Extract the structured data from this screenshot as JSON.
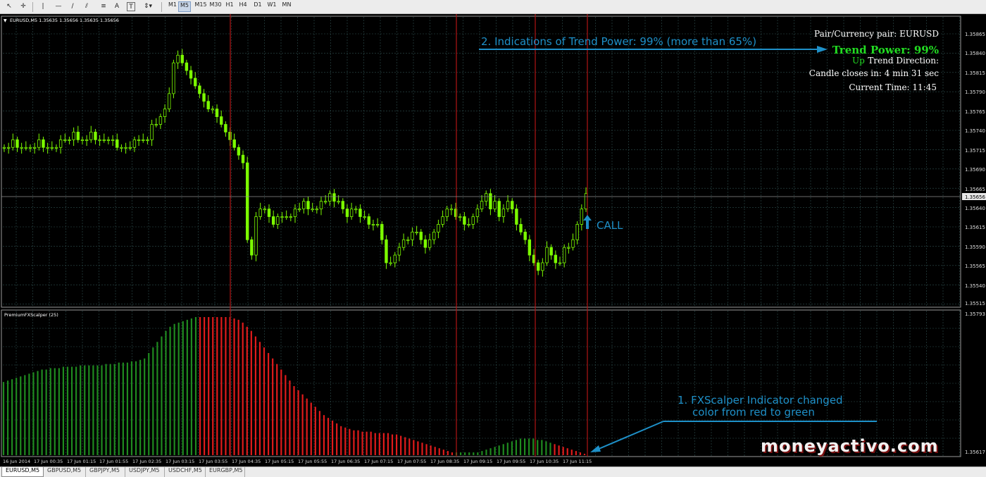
{
  "toolbar": {
    "tools": [
      "cursor-tool",
      "crosshair-tool",
      "vertical-line-tool",
      "horizontal-line-tool",
      "trendline-tool",
      "channel-tool",
      "fibonacci-tool",
      "text-tool",
      "label-tool",
      "arrows-tool"
    ],
    "text_tool_label": "A",
    "label_tool_label": "T",
    "timeframes": [
      "M1",
      "M5",
      "M15",
      "M30",
      "H1",
      "H4",
      "D1",
      "W1",
      "MN"
    ],
    "active_timeframe": "M5"
  },
  "main_chart": {
    "header": "EURUSD,M5  1.35635 1.35656 1.35635 1.35656",
    "price_ticks": [
      "1.35865",
      "1.35840",
      "1.35815",
      "1.35790",
      "1.35765",
      "1.35740",
      "1.35715",
      "1.35690",
      "1.35665",
      "1.35640",
      "1.35615",
      "1.35590",
      "1.35565",
      "1.35540",
      "1.35515"
    ],
    "current_price": "1.35656",
    "call_label": "CALL"
  },
  "indicator": {
    "name": "PremiumFXScalper (25)",
    "scale_top": "1.35793",
    "scale_bottom": "1.35617"
  },
  "info_panel": {
    "pair": "Pair/Currency pair: EURUSD",
    "trend_power": "Trend Power: 99%",
    "trend_direction_prefix": "Up",
    "trend_direction": "Trend Direction:",
    "candle_closes": "Candle closes in: 4 min 31 sec",
    "current_time": "Current Time: 11:45"
  },
  "annotations": {
    "trend_note": "2. Indications of Trend Power: 99% (more than 65%)",
    "indicator_note_line1": "1. FXScalper Indicator changed",
    "indicator_note_line2": "color from red to green"
  },
  "watermark": "moneyactivo.com",
  "time_axis": [
    "16 Jun 2014",
    "17 Jun 00:35",
    "17 Jun 01:15",
    "17 Jun 01:55",
    "17 Jun 02:35",
    "17 Jun 03:15",
    "17 Jun 03:55",
    "17 Jun 04:35",
    "17 Jun 05:15",
    "17 Jun 05:55",
    "17 Jun 06:35",
    "17 Jun 07:15",
    "17 Jun 07:55",
    "17 Jun 08:35",
    "17 Jun 09:15",
    "17 Jun 09:55",
    "17 Jun 10:35",
    "17 Jun 11:15"
  ],
  "symbol_tabs": [
    "EURUSD,M5",
    "GBPUSD,M5",
    "GBPJPY,M5",
    "USDJPY,M5",
    "USDCHF,M5",
    "EURGBP,M5"
  ],
  "active_tab": "EURUSD,M5",
  "colors": {
    "background": "#000000",
    "grid": "#2f4f4f",
    "candle": "#7cfc00",
    "histogram_green": "#1f8a1f",
    "histogram_red": "#e01b1b",
    "vertical_markers": "#b01414",
    "annotation": "#1e90c8",
    "trend_power": "#22dd22",
    "info_text": "#ffffff"
  },
  "chart_data": {
    "type": "candlestick",
    "price_close_trace": [
      1.3572,
      1.3572,
      1.3573,
      1.3572,
      1.3572,
      1.3572,
      1.3572,
      1.3572,
      1.3573,
      1.3572,
      1.3572,
      1.3572,
      1.3572,
      1.3573,
      1.3573,
      1.3573,
      1.3574,
      1.3573,
      1.3573,
      1.3573,
      1.3574,
      1.3573,
      1.3573,
      1.3573,
      1.3573,
      1.3573,
      1.3572,
      1.3572,
      1.3572,
      1.3572,
      1.3573,
      1.3573,
      1.3573,
      1.3573,
      1.3575,
      1.3575,
      1.3576,
      1.3577,
      1.3579,
      1.3583,
      1.3584,
      1.3583,
      1.3582,
      1.3581,
      1.358,
      1.3579,
      1.3578,
      1.3577,
      1.3577,
      1.3576,
      1.3575,
      1.3574,
      1.3573,
      1.3572,
      1.3571,
      1.357,
      1.356,
      1.3558,
      1.3563,
      1.3564,
      1.3564,
      1.3563,
      1.3562,
      1.3563,
      1.3563,
      1.3563,
      1.3563,
      1.3564,
      1.3564,
      1.3565,
      1.3564,
      1.3564,
      1.3564,
      1.3565,
      1.3565,
      1.3566,
      1.3565,
      1.3565,
      1.3564,
      1.3563,
      1.3564,
      1.3564,
      1.3563,
      1.3563,
      1.3562,
      1.3562,
      1.3562,
      1.356,
      1.3557,
      1.3557,
      1.3558,
      1.3559,
      1.356,
      1.356,
      1.3561,
      1.3561,
      1.356,
      1.3559,
      1.356,
      1.3561,
      1.3562,
      1.3563,
      1.3564,
      1.3564,
      1.3563,
      1.3563,
      1.3562,
      1.3562,
      1.3563,
      1.3564,
      1.3565,
      1.3566,
      1.3564,
      1.3565,
      1.3563,
      1.3564,
      1.3565,
      1.3564,
      1.3562,
      1.3561,
      1.356,
      1.3558,
      1.3557,
      1.3556,
      1.3557,
      1.3559,
      1.3558,
      1.3557,
      1.3557,
      1.3559,
      1.3559,
      1.356,
      1.3562,
      1.3564,
      1.3566
    ],
    "histogram": [
      0.53,
      0.54,
      0.55,
      0.56,
      0.57,
      0.58,
      0.59,
      0.6,
      0.61,
      0.62,
      0.62,
      0.63,
      0.63,
      0.63,
      0.64,
      0.64,
      0.64,
      0.64,
      0.65,
      0.65,
      0.65,
      0.65,
      0.65,
      0.65,
      0.66,
      0.66,
      0.66,
      0.67,
      0.67,
      0.67,
      0.68,
      0.68,
      0.69,
      0.7,
      0.74,
      0.78,
      0.82,
      0.86,
      0.9,
      0.93,
      0.95,
      0.96,
      0.97,
      0.98,
      0.99,
      1.0,
      1.0,
      1.0,
      1.0,
      1.0,
      1.0,
      1.0,
      1.0,
      1.0,
      0.99,
      0.98,
      0.96,
      0.93,
      0.9,
      0.86,
      0.82,
      0.78,
      0.74,
      0.7,
      0.66,
      0.62,
      0.58,
      0.54,
      0.5,
      0.47,
      0.44,
      0.41,
      0.38,
      0.35,
      0.32,
      0.29,
      0.27,
      0.25,
      0.23,
      0.21,
      0.2,
      0.19,
      0.18,
      0.18,
      0.17,
      0.17,
      0.17,
      0.16,
      0.16,
      0.16,
      0.16,
      0.15,
      0.15,
      0.14,
      0.13,
      0.12,
      0.11,
      0.1,
      0.09,
      0.08,
      0.07,
      0.06,
      0.05,
      0.04,
      0.03,
      0.02,
      0.02,
      0.02,
      0.02,
      0.02,
      0.02,
      0.02,
      0.03,
      0.04,
      0.05,
      0.06,
      0.07,
      0.08,
      0.09,
      0.1,
      0.11,
      0.12,
      0.12,
      0.12,
      0.12,
      0.11,
      0.11,
      0.1,
      0.09,
      0.08,
      0.07,
      0.06,
      0.05,
      0.04,
      0.03,
      0.02,
      0.01
    ],
    "histogram_colors": [
      "g",
      "g",
      "g",
      "g",
      "g",
      "g",
      "g",
      "g",
      "g",
      "g",
      "g",
      "g",
      "g",
      "g",
      "g",
      "g",
      "g",
      "g",
      "g",
      "g",
      "g",
      "g",
      "g",
      "g",
      "g",
      "g",
      "g",
      "g",
      "g",
      "g",
      "g",
      "g",
      "g",
      "g",
      "g",
      "g",
      "g",
      "g",
      "g",
      "g",
      "g",
      "g",
      "g",
      "g",
      "g",
      "g",
      "r",
      "r",
      "r",
      "r",
      "r",
      "r",
      "r",
      "r",
      "r",
      "r",
      "r",
      "r",
      "r",
      "r",
      "r",
      "r",
      "r",
      "r",
      "r",
      "r",
      "r",
      "r",
      "r",
      "r",
      "r",
      "r",
      "r",
      "r",
      "r",
      "r",
      "r",
      "r",
      "r",
      "r",
      "r",
      "r",
      "r",
      "r",
      "r",
      "r",
      "r",
      "r",
      "r",
      "r",
      "r",
      "r",
      "r",
      "r",
      "r",
      "r",
      "r",
      "r",
      "r",
      "r",
      "r",
      "r",
      "r",
      "r",
      "r",
      "r",
      "g",
      "g",
      "g",
      "g",
      "g",
      "g",
      "g",
      "g",
      "g",
      "g",
      "g",
      "g",
      "g",
      "g",
      "g",
      "g",
      "g",
      "g",
      "g",
      "g",
      "g",
      "g",
      "g",
      "r",
      "r",
      "r",
      "r",
      "r",
      "r",
      "r",
      "r",
      "r",
      "r",
      "r",
      "r",
      "r",
      "r",
      "r",
      "r"
    ]
  }
}
